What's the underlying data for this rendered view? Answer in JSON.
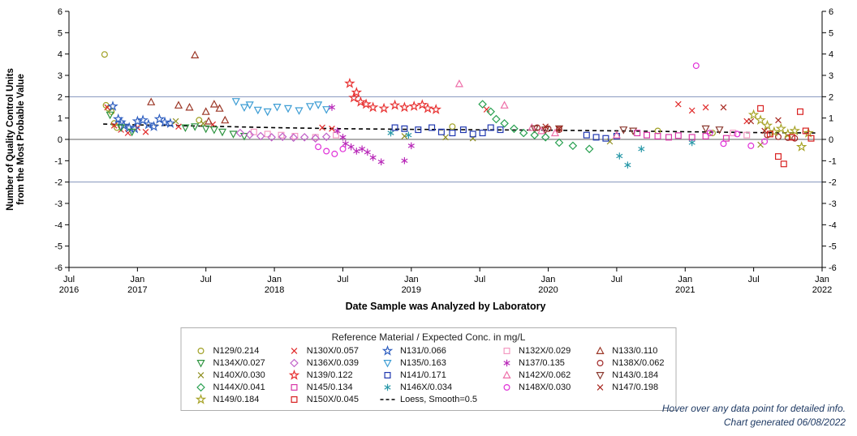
{
  "chart_data": {
    "type": "scatter",
    "xlabel": "Date Sample was Analyzed by Laboratory",
    "ylabel_lines": [
      "Number of Quality Control Units",
      "from the Most Probable Value"
    ],
    "ylim": [
      -6,
      6
    ],
    "ytick_step": 1,
    "xlim": [
      2016.5,
      2022.0
    ],
    "xticks": [
      {
        "x": 2016.5,
        "top": "Jul",
        "bottom": "2016"
      },
      {
        "x": 2017.0,
        "top": "Jan",
        "bottom": "2017"
      },
      {
        "x": 2017.5,
        "top": "Jul",
        "bottom": ""
      },
      {
        "x": 2018.0,
        "top": "Jan",
        "bottom": "2018"
      },
      {
        "x": 2018.5,
        "top": "Jul",
        "bottom": ""
      },
      {
        "x": 2019.0,
        "top": "Jan",
        "bottom": "2019"
      },
      {
        "x": 2019.5,
        "top": "Jul",
        "bottom": ""
      },
      {
        "x": 2020.0,
        "top": "Jan",
        "bottom": "2020"
      },
      {
        "x": 2020.5,
        "top": "Jul",
        "bottom": ""
      },
      {
        "x": 2021.0,
        "top": "Jan",
        "bottom": "2021"
      },
      {
        "x": 2021.5,
        "top": "Jul",
        "bottom": ""
      },
      {
        "x": 2022.0,
        "top": "Jan",
        "bottom": "2022"
      }
    ],
    "reference_lines": [
      {
        "y": 2,
        "color": "#8295bd"
      },
      {
        "y": 0,
        "color": "#606060"
      },
      {
        "y": -2,
        "color": "#8295bd"
      }
    ],
    "legend_title": "Reference Material / Expected Conc. in mg/L",
    "series": [
      {
        "name": "N129/0.214",
        "marker": "circle",
        "color": "#a0a024",
        "points": [
          [
            2016.76,
            3.98
          ],
          [
            2016.77,
            1.6
          ],
          [
            2016.79,
            1.45
          ],
          [
            2016.81,
            1.3
          ],
          [
            2016.83,
            0.75
          ],
          [
            2016.85,
            0.55
          ],
          [
            2017.45,
            0.9
          ],
          [
            2019.3,
            0.6
          ],
          [
            2020.8,
            0.4
          ],
          [
            2021.2,
            0.3
          ]
        ]
      },
      {
        "name": "N130X/0.057",
        "marker": "x",
        "color": "#e02828",
        "points": [
          [
            2016.78,
            1.5
          ],
          [
            2016.83,
            0.65
          ],
          [
            2016.88,
            0.45
          ],
          [
            2016.93,
            0.3
          ],
          [
            2017.0,
            0.55
          ],
          [
            2017.06,
            0.35
          ],
          [
            2017.3,
            0.6
          ],
          [
            2017.55,
            0.7
          ],
          [
            2018.35,
            0.55
          ],
          [
            2018.42,
            0.5
          ],
          [
            2019.55,
            1.4
          ],
          [
            2020.95,
            1.65
          ],
          [
            2021.05,
            1.35
          ],
          [
            2021.15,
            1.5
          ],
          [
            2021.45,
            0.85
          ]
        ]
      },
      {
        "name": "N131/0.066",
        "marker": "star",
        "color": "#2f5fc0",
        "points": [
          [
            2016.82,
            1.55
          ],
          [
            2016.86,
            0.95
          ],
          [
            2016.88,
            0.8
          ],
          [
            2016.9,
            0.65
          ],
          [
            2016.94,
            0.55
          ],
          [
            2016.98,
            0.5
          ],
          [
            2017.0,
            0.85
          ],
          [
            2017.04,
            0.9
          ],
          [
            2017.08,
            0.7
          ],
          [
            2017.12,
            0.6
          ],
          [
            2017.16,
            0.95
          ],
          [
            2017.2,
            0.8
          ],
          [
            2017.24,
            0.75
          ]
        ]
      },
      {
        "name": "N132X/0.029",
        "marker": "square",
        "color": "#f49ac2",
        "points": [
          [
            2017.85,
            0.35
          ],
          [
            2017.95,
            0.25
          ],
          [
            2018.05,
            0.2
          ],
          [
            2018.15,
            0.15
          ],
          [
            2018.3,
            0.1
          ],
          [
            2018.45,
            0.2
          ],
          [
            2021.35,
            0.3
          ],
          [
            2021.45,
            0.2
          ]
        ]
      },
      {
        "name": "N133/0.110",
        "marker": "triangle-up",
        "color": "#9c3828",
        "points": [
          [
            2017.1,
            1.75
          ],
          [
            2017.3,
            1.6
          ],
          [
            2017.38,
            1.5
          ],
          [
            2017.42,
            3.95
          ],
          [
            2017.5,
            1.3
          ],
          [
            2017.52,
            0.85
          ],
          [
            2017.56,
            1.65
          ],
          [
            2017.6,
            1.45
          ],
          [
            2017.64,
            0.9
          ]
        ]
      },
      {
        "name": "N134X/0.027",
        "marker": "triangle-down",
        "color": "#2e9440",
        "points": [
          [
            2016.8,
            1.15
          ],
          [
            2016.88,
            0.55
          ],
          [
            2016.96,
            0.35
          ],
          [
            2017.35,
            0.55
          ],
          [
            2017.42,
            0.6
          ],
          [
            2017.5,
            0.5
          ],
          [
            2017.56,
            0.45
          ],
          [
            2017.62,
            0.35
          ],
          [
            2017.7,
            0.25
          ],
          [
            2017.78,
            0.15
          ]
        ]
      },
      {
        "name": "N136X/0.039",
        "marker": "diamond",
        "color": "#c060c8",
        "points": [
          [
            2017.75,
            0.3
          ],
          [
            2017.82,
            0.22
          ],
          [
            2017.9,
            0.15
          ],
          [
            2017.98,
            0.1
          ],
          [
            2018.06,
            0.12
          ],
          [
            2018.14,
            0.08
          ],
          [
            2018.22,
            0.1
          ],
          [
            2018.3,
            0.05
          ],
          [
            2018.38,
            0.12
          ]
        ]
      },
      {
        "name": "N135/0.163",
        "marker": "triangle-down",
        "color": "#3d9dd4",
        "points": [
          [
            2017.72,
            1.78
          ],
          [
            2017.78,
            1.5
          ],
          [
            2017.82,
            1.62
          ],
          [
            2017.88,
            1.38
          ],
          [
            2017.95,
            1.3
          ],
          [
            2018.02,
            1.52
          ],
          [
            2018.1,
            1.45
          ],
          [
            2018.18,
            1.35
          ],
          [
            2018.26,
            1.55
          ],
          [
            2018.32,
            1.62
          ],
          [
            2018.38,
            1.4
          ]
        ]
      },
      {
        "name": "N137/0.135",
        "marker": "asterisk",
        "color": "#b828b8",
        "points": [
          [
            2018.42,
            1.5
          ],
          [
            2018.46,
            0.4
          ],
          [
            2018.5,
            0.1
          ],
          [
            2018.52,
            -0.2
          ],
          [
            2018.56,
            -0.35
          ],
          [
            2018.6,
            -0.55
          ],
          [
            2018.64,
            -0.45
          ],
          [
            2018.68,
            -0.6
          ],
          [
            2018.72,
            -0.85
          ],
          [
            2018.78,
            -1.05
          ],
          [
            2018.95,
            -1.0
          ],
          [
            2019.0,
            -0.3
          ]
        ]
      },
      {
        "name": "N138X/0.062",
        "marker": "circle",
        "color": "#a02828",
        "points": [
          [
            2019.92,
            0.55
          ],
          [
            2020.0,
            0.5
          ],
          [
            2020.08,
            0.45
          ],
          [
            2021.6,
            0.2
          ],
          [
            2021.68,
            0.12
          ],
          [
            2021.75,
            0.08
          ],
          [
            2021.8,
            0.05
          ]
        ]
      },
      {
        "name": "N140X/0.030",
        "marker": "x",
        "color": "#8f8f20",
        "points": [
          [
            2017.28,
            0.85
          ],
          [
            2017.48,
            0.75
          ],
          [
            2018.95,
            0.15
          ],
          [
            2019.25,
            0.1
          ],
          [
            2019.45,
            0.05
          ],
          [
            2020.45,
            -0.1
          ],
          [
            2021.55,
            -0.25
          ]
        ]
      },
      {
        "name": "N139/0.122",
        "marker": "star",
        "color": "#e83030",
        "points": [
          [
            2018.55,
            2.62
          ],
          [
            2018.58,
            1.95
          ],
          [
            2018.6,
            2.2
          ],
          [
            2018.63,
            1.75
          ],
          [
            2018.67,
            1.65
          ],
          [
            2018.72,
            1.5
          ],
          [
            2018.8,
            1.45
          ],
          [
            2018.88,
            1.6
          ],
          [
            2018.95,
            1.5
          ],
          [
            2019.02,
            1.55
          ],
          [
            2019.08,
            1.62
          ],
          [
            2019.12,
            1.45
          ],
          [
            2019.18,
            1.4
          ]
        ]
      },
      {
        "name": "N141/0.171",
        "marker": "square",
        "color": "#2038b0",
        "points": [
          [
            2018.88,
            0.55
          ],
          [
            2018.95,
            0.5
          ],
          [
            2019.05,
            0.45
          ],
          [
            2019.15,
            0.55
          ],
          [
            2019.22,
            0.35
          ],
          [
            2019.3,
            0.3
          ],
          [
            2019.38,
            0.45
          ],
          [
            2019.45,
            0.25
          ],
          [
            2019.52,
            0.3
          ],
          [
            2019.58,
            0.55
          ],
          [
            2019.65,
            0.45
          ],
          [
            2020.28,
            0.2
          ],
          [
            2020.35,
            0.1
          ],
          [
            2020.42,
            0.05
          ],
          [
            2020.5,
            0.15
          ]
        ]
      },
      {
        "name": "N142X/0.062",
        "marker": "triangle-up",
        "color": "#ee6ea8",
        "points": [
          [
            2019.35,
            2.6
          ],
          [
            2019.68,
            1.6
          ],
          [
            2019.88,
            0.55
          ],
          [
            2019.95,
            0.4
          ],
          [
            2020.05,
            0.3
          ],
          [
            2020.5,
            0.2
          ]
        ]
      },
      {
        "name": "N143/0.184",
        "marker": "triangle-down",
        "color": "#8b3a30",
        "points": [
          [
            2019.9,
            0.5
          ],
          [
            2019.98,
            0.45
          ],
          [
            2020.08,
            0.5
          ],
          [
            2020.55,
            0.45
          ],
          [
            2020.62,
            0.4
          ],
          [
            2021.15,
            0.5
          ],
          [
            2021.25,
            0.45
          ]
        ]
      },
      {
        "name": "N144X/0.041",
        "marker": "diamond",
        "color": "#28a050",
        "points": [
          [
            2019.52,
            1.65
          ],
          [
            2019.58,
            1.3
          ],
          [
            2019.62,
            0.95
          ],
          [
            2019.68,
            0.75
          ],
          [
            2019.75,
            0.5
          ],
          [
            2019.82,
            0.3
          ],
          [
            2019.9,
            0.2
          ],
          [
            2019.98,
            0.1
          ],
          [
            2020.08,
            -0.15
          ],
          [
            2020.18,
            -0.3
          ],
          [
            2020.3,
            -0.45
          ]
        ]
      },
      {
        "name": "N145/0.134",
        "marker": "square",
        "color": "#d838a8",
        "points": [
          [
            2020.65,
            0.3
          ],
          [
            2020.72,
            0.2
          ],
          [
            2020.8,
            0.15
          ],
          [
            2020.88,
            0.1
          ],
          [
            2020.95,
            0.18
          ],
          [
            2021.05,
            0.1
          ],
          [
            2021.15,
            0.15
          ],
          [
            2021.3,
            0.05
          ]
        ]
      },
      {
        "name": "N146X/0.034",
        "marker": "asterisk",
        "color": "#2898a8",
        "points": [
          [
            2018.85,
            0.3
          ],
          [
            2018.98,
            0.2
          ],
          [
            2020.52,
            -0.78
          ],
          [
            2020.58,
            -1.2
          ],
          [
            2020.68,
            -0.45
          ],
          [
            2021.05,
            -0.15
          ]
        ]
      },
      {
        "name": "N148X/0.030",
        "marker": "circle",
        "color": "#e030d8",
        "points": [
          [
            2018.32,
            -0.35
          ],
          [
            2018.38,
            -0.55
          ],
          [
            2018.44,
            -0.68
          ],
          [
            2018.5,
            -0.45
          ],
          [
            2021.08,
            3.45
          ],
          [
            2021.18,
            0.3
          ],
          [
            2021.28,
            -0.2
          ],
          [
            2021.38,
            0.25
          ],
          [
            2021.48,
            -0.3
          ],
          [
            2021.58,
            -0.1
          ]
        ]
      },
      {
        "name": "N147/0.198",
        "marker": "x",
        "color": "#a82820",
        "points": [
          [
            2019.98,
            0.6
          ],
          [
            2020.08,
            0.5
          ],
          [
            2021.28,
            1.5
          ],
          [
            2021.48,
            0.85
          ],
          [
            2021.58,
            0.4
          ],
          [
            2021.68,
            0.9
          ]
        ]
      },
      {
        "name": "N149/0.184",
        "marker": "star",
        "color": "#a8a428",
        "points": [
          [
            2021.5,
            1.15
          ],
          [
            2021.55,
            0.9
          ],
          [
            2021.6,
            0.65
          ],
          [
            2021.65,
            0.35
          ],
          [
            2021.7,
            0.5
          ],
          [
            2021.75,
            0.25
          ],
          [
            2021.8,
            0.4
          ],
          [
            2021.85,
            -0.35
          ],
          [
            2021.9,
            0.3
          ]
        ]
      },
      {
        "name": "N150X/0.045",
        "marker": "square",
        "color": "#d82020",
        "points": [
          [
            2021.55,
            1.45
          ],
          [
            2021.62,
            0.25
          ],
          [
            2021.68,
            -0.8
          ],
          [
            2021.72,
            -1.15
          ],
          [
            2021.78,
            0.1
          ],
          [
            2021.84,
            1.3
          ],
          [
            2021.88,
            0.4
          ],
          [
            2021.92,
            0.05
          ]
        ]
      }
    ],
    "loess": {
      "label": "Loess, Smooth=0.5",
      "color": "#000000",
      "dash": "5 4",
      "points": [
        [
          2016.75,
          0.72
        ],
        [
          2017.0,
          0.68
        ],
        [
          2017.5,
          0.62
        ],
        [
          2018.0,
          0.55
        ],
        [
          2018.5,
          0.5
        ],
        [
          2019.0,
          0.47
        ],
        [
          2019.5,
          0.45
        ],
        [
          2020.0,
          0.43
        ],
        [
          2020.5,
          0.4
        ],
        [
          2021.0,
          0.36
        ],
        [
          2021.5,
          0.32
        ],
        [
          2021.95,
          0.3
        ]
      ]
    }
  },
  "footer": {
    "line1": "Hover over any data point for detailed info.",
    "line2": "Chart generated 06/08/2022"
  }
}
